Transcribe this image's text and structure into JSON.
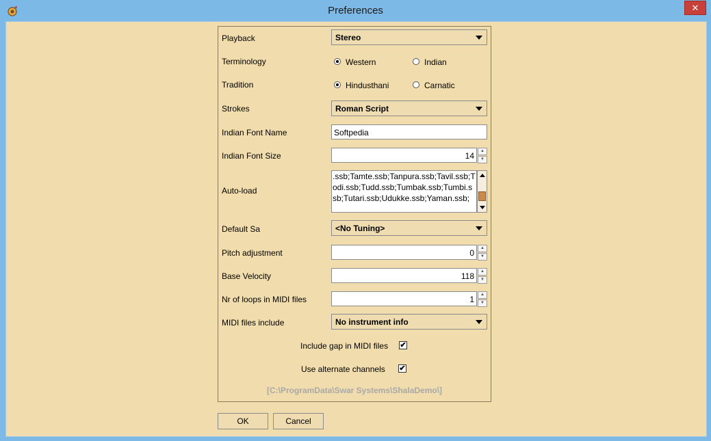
{
  "window": {
    "title": "Preferences",
    "close_label": "✕"
  },
  "form": {
    "playback": {
      "label": "Playback",
      "value": "Stereo"
    },
    "terminology": {
      "label": "Terminology",
      "options": [
        "Western",
        "Indian"
      ],
      "selected": "Western"
    },
    "tradition": {
      "label": "Tradition",
      "options": [
        "Hindusthani",
        "Carnatic"
      ],
      "selected": "Hindusthani"
    },
    "strokes": {
      "label": "Strokes",
      "value": "Roman Script"
    },
    "font_name": {
      "label": "Indian Font Name",
      "value": "Softpedia"
    },
    "font_size": {
      "label": "Indian Font Size",
      "value": "14"
    },
    "autoload": {
      "label": "Auto-load",
      "value": ".ssb;Tamte.ssb;Tanpura.ssb;Tavil.ssb;Todi.ssb;Tudd.ssb;Tumbak.ssb;Tumbi.ssb;Tutari.ssb;Udukke.ssb;Yaman.ssb;"
    },
    "default_sa": {
      "label": "Default Sa",
      "value": "<No Tuning>"
    },
    "pitch": {
      "label": "Pitch adjustment",
      "value": "0"
    },
    "velocity": {
      "label": "Base Velocity",
      "value": "118"
    },
    "loops": {
      "label": "Nr of loops in MIDI files",
      "value": "1"
    },
    "midi_include": {
      "label": "MIDI files include",
      "value": "No instrument info"
    },
    "include_gap": {
      "label": "Include gap in MIDI files",
      "checked": true,
      "mark": "✔"
    },
    "alt_channels": {
      "label": "Use alternate channels",
      "checked": true,
      "mark": "✔"
    },
    "path": "[C:\\ProgramData\\Swar Systems\\ShalaDemo\\]"
  },
  "buttons": {
    "ok": "OK",
    "cancel": "Cancel"
  },
  "spin_glyphs": {
    "up": "▲",
    "down": "▼"
  }
}
